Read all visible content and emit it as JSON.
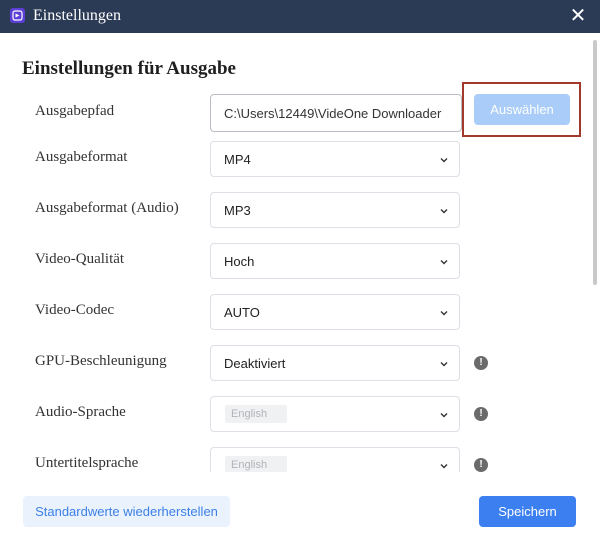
{
  "window": {
    "title": "Einstellungen",
    "app_icon": "app-logo-icon",
    "close_symbol": "✕"
  },
  "section": {
    "title": "Einstellungen für Ausgabe"
  },
  "path": {
    "label": "Ausgabepfad",
    "value": "C:\\Users\\12449\\VideOne Downloader",
    "button": "Auswählen"
  },
  "rows": [
    {
      "label": "Ausgabeformat",
      "value": "MP4"
    },
    {
      "label": "Ausgabeformat (Audio)",
      "value": "MP3"
    },
    {
      "label": "Video-Qualität",
      "value": "Hoch"
    },
    {
      "label": "Video-Codec",
      "value": "AUTO"
    },
    {
      "label": "GPU-Beschleunigung",
      "value": "Deaktiviert"
    },
    {
      "label": "Audio-Sprache",
      "value": "English"
    },
    {
      "label": "Untertitelsprache",
      "value": "English"
    }
  ],
  "info_symbol": "!",
  "footer": {
    "reset": "Standardwerte wiederherstellen",
    "save": "Speichern"
  },
  "colors": {
    "titlebar": "#2b3a55",
    "primary": "#3b7ff0",
    "highlight_border": "#a23a2c"
  }
}
